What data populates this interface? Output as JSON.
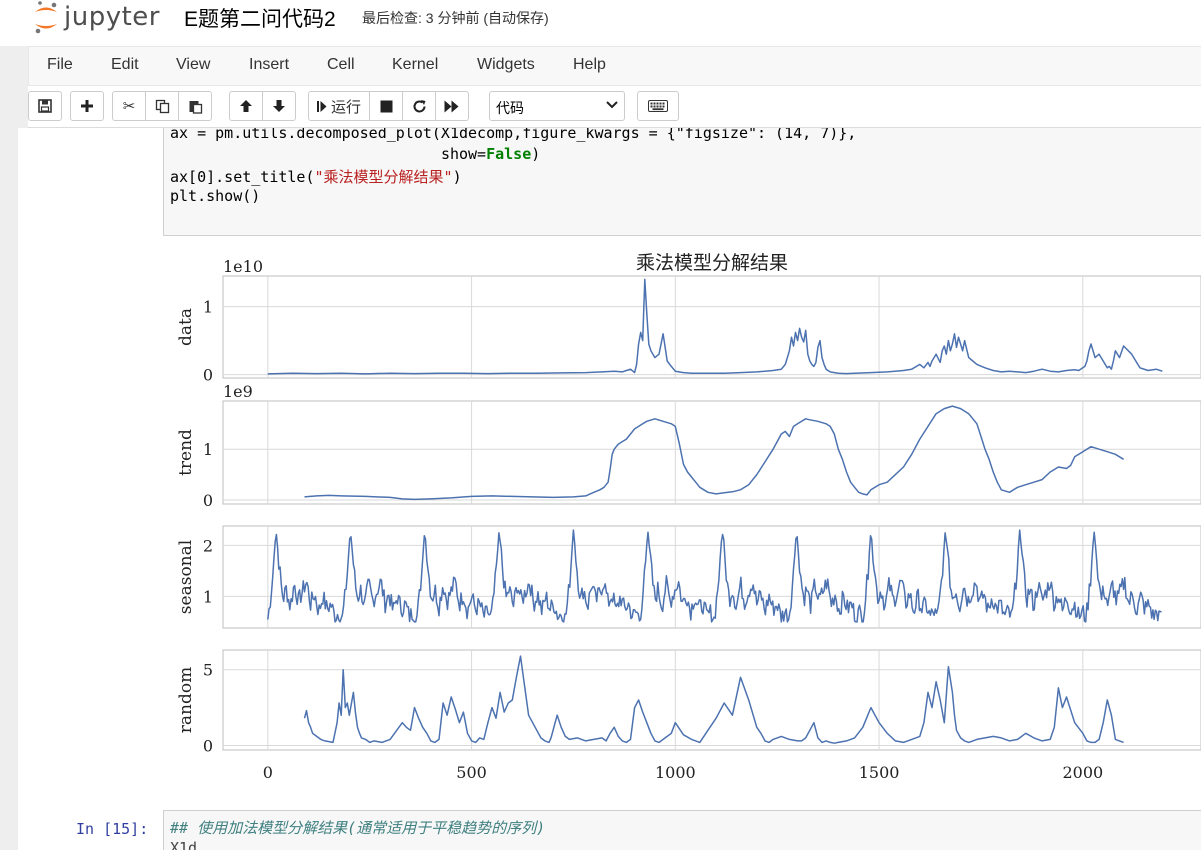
{
  "header": {
    "logo_text": "jupyter",
    "notebook_title": "E题第二问代码2",
    "status": "最后检查: 3 分钟前 (自动保存)"
  },
  "menu": [
    "File",
    "Edit",
    "View",
    "Insert",
    "Cell",
    "Kernel",
    "Widgets",
    "Help"
  ],
  "toolbar": {
    "run_label": "运行",
    "cell_type": "代码",
    "icons": [
      "save-icon",
      "plus-icon",
      "scissors-icon",
      "copy-icon",
      "paste-icon",
      "arrow-up-icon",
      "arrow-down-icon",
      "run-icon",
      "stop-icon",
      "restart-icon",
      "fast-forward-icon",
      "keyboard-icon"
    ]
  },
  "cell1": {
    "line1": "ax = pm.utils.decomposed_plot(X1decomp,figure_kwargs = {\"figsize\": (14, 7)},",
    "line2_prefix": "show=",
    "line2_kw": "False",
    "line2_suffix": ")",
    "line3_prefix": "ax[0].set_title(",
    "line3_str": "\"乘法模型分解结果\"",
    "line3_suffix": ")",
    "line4": "plt.show()"
  },
  "cell2": {
    "prompt": "In  [15]:",
    "comment": "## 使用加法模型分解结果(通常适用于平稳趋势的序列)",
    "partial_line": "X1d..."
  },
  "chart_data": [
    {
      "type": "line",
      "title": "乘法模型分解结果",
      "ylabel": "data",
      "offset_text": "1e10",
      "ylim": [
        -0.05,
        1.45
      ],
      "yticks": [
        0,
        1
      ],
      "xlim": [
        -110,
        2290
      ],
      "grid": true,
      "color": "#4c72b0",
      "x": [
        0,
        60,
        120,
        180,
        240,
        300,
        360,
        420,
        480,
        540,
        600,
        660,
        720,
        780,
        820,
        850,
        870,
        880,
        890,
        900,
        905,
        910,
        915,
        920,
        925,
        930,
        935,
        940,
        950,
        960,
        970,
        980,
        990,
        1000,
        1020,
        1040,
        1080,
        1120,
        1160,
        1200,
        1240,
        1260,
        1270,
        1280,
        1285,
        1290,
        1295,
        1300,
        1305,
        1310,
        1315,
        1320,
        1325,
        1330,
        1335,
        1340,
        1345,
        1350,
        1355,
        1360,
        1365,
        1370,
        1380,
        1390,
        1400,
        1420,
        1440,
        1480,
        1520,
        1560,
        1580,
        1600,
        1610,
        1620,
        1625,
        1630,
        1640,
        1650,
        1655,
        1660,
        1665,
        1670,
        1675,
        1680,
        1685,
        1690,
        1695,
        1700,
        1705,
        1710,
        1720,
        1730,
        1740,
        1760,
        1780,
        1800,
        1820,
        1840,
        1860,
        1880,
        1900,
        1920,
        1940,
        1960,
        1980,
        1990,
        2000,
        2005,
        2010,
        2015,
        2020,
        2030,
        2040,
        2050,
        2055,
        2060,
        2065,
        2070,
        2075,
        2080,
        2090,
        2100,
        2120,
        2140,
        2160,
        2180,
        2195
      ],
      "y": [
        0.01,
        0.02,
        0.015,
        0.02,
        0.01,
        0.02,
        0.015,
        0.02,
        0.02,
        0.015,
        0.02,
        0.02,
        0.025,
        0.03,
        0.04,
        0.05,
        0.04,
        0.06,
        0.08,
        0.03,
        0.15,
        0.45,
        0.62,
        0.5,
        1.4,
        0.9,
        0.45,
        0.35,
        0.25,
        0.3,
        0.6,
        0.2,
        0.12,
        0.05,
        0.03,
        0.02,
        0.02,
        0.02,
        0.03,
        0.04,
        0.06,
        0.08,
        0.15,
        0.35,
        0.55,
        0.42,
        0.62,
        0.5,
        0.68,
        0.55,
        0.48,
        0.65,
        0.3,
        0.2,
        0.15,
        0.12,
        0.18,
        0.4,
        0.5,
        0.25,
        0.15,
        0.08,
        0.04,
        0.03,
        0.02,
        0.015,
        0.02,
        0.03,
        0.04,
        0.06,
        0.08,
        0.15,
        0.1,
        0.18,
        0.12,
        0.2,
        0.3,
        0.18,
        0.35,
        0.42,
        0.3,
        0.5,
        0.35,
        0.45,
        0.6,
        0.4,
        0.55,
        0.45,
        0.35,
        0.5,
        0.25,
        0.2,
        0.15,
        0.1,
        0.06,
        0.04,
        0.05,
        0.04,
        0.03,
        0.05,
        0.08,
        0.05,
        0.04,
        0.06,
        0.07,
        0.06,
        0.1,
        0.12,
        0.2,
        0.35,
        0.45,
        0.25,
        0.3,
        0.2,
        0.15,
        0.1,
        0.12,
        0.08,
        0.2,
        0.35,
        0.25,
        0.42,
        0.3,
        0.1,
        0.06,
        0.08,
        0.05,
        0.04,
        0.04,
        0.03,
        0.02
      ]
    },
    {
      "type": "line",
      "ylabel": "trend",
      "offset_text": "1e9",
      "ylim": [
        -0.08,
        1.95
      ],
      "yticks": [
        0,
        1
      ],
      "xlim": [
        -110,
        2290
      ],
      "grid": true,
      "color": "#4c72b0",
      "x": [
        90,
        120,
        150,
        180,
        240,
        300,
        330,
        360,
        400,
        450,
        500,
        550,
        600,
        650,
        700,
        750,
        780,
        800,
        815,
        825,
        835,
        840,
        845,
        850,
        860,
        880,
        890,
        900,
        910,
        920,
        930,
        950,
        970,
        990,
        1000,
        1010,
        1020,
        1030,
        1040,
        1050,
        1060,
        1080,
        1100,
        1120,
        1140,
        1160,
        1180,
        1200,
        1220,
        1240,
        1250,
        1260,
        1270,
        1280,
        1290,
        1300,
        1310,
        1320,
        1330,
        1350,
        1370,
        1380,
        1390,
        1400,
        1410,
        1420,
        1430,
        1440,
        1450,
        1460,
        1470,
        1480,
        1500,
        1520,
        1540,
        1560,
        1580,
        1600,
        1620,
        1640,
        1660,
        1680,
        1700,
        1720,
        1740,
        1750,
        1760,
        1770,
        1780,
        1790,
        1800,
        1820,
        1840,
        1860,
        1880,
        1900,
        1920,
        1940,
        1960,
        1970,
        1980,
        2000,
        2020,
        2040,
        2060,
        2080,
        2090,
        2100
      ],
      "y": [
        0.06,
        0.08,
        0.09,
        0.08,
        0.07,
        0.05,
        0.02,
        0.01,
        0.02,
        0.04,
        0.07,
        0.08,
        0.07,
        0.06,
        0.05,
        0.06,
        0.08,
        0.15,
        0.2,
        0.25,
        0.35,
        0.6,
        0.9,
        1.0,
        1.1,
        1.2,
        1.3,
        1.4,
        1.45,
        1.5,
        1.55,
        1.6,
        1.55,
        1.5,
        1.45,
        1.1,
        0.7,
        0.55,
        0.45,
        0.35,
        0.25,
        0.15,
        0.12,
        0.14,
        0.16,
        0.2,
        0.3,
        0.5,
        0.75,
        1.0,
        1.15,
        1.3,
        1.35,
        1.25,
        1.45,
        1.5,
        1.55,
        1.6,
        1.58,
        1.55,
        1.5,
        1.45,
        1.3,
        1.0,
        0.8,
        0.55,
        0.35,
        0.25,
        0.15,
        0.12,
        0.1,
        0.2,
        0.3,
        0.35,
        0.5,
        0.65,
        0.9,
        1.2,
        1.45,
        1.7,
        1.8,
        1.85,
        1.8,
        1.7,
        1.5,
        1.25,
        1.0,
        0.8,
        0.55,
        0.35,
        0.2,
        0.15,
        0.25,
        0.3,
        0.35,
        0.4,
        0.55,
        0.65,
        0.62,
        0.68,
        0.85,
        0.95,
        1.05,
        1.0,
        0.95,
        0.9,
        0.85,
        0.8
      ]
    },
    {
      "type": "line",
      "ylabel": "seasonal",
      "ylim": [
        0.38,
        2.38
      ],
      "yticks": [
        1,
        2
      ],
      "xlim": [
        -110,
        2290
      ],
      "grid": true,
      "color": "#4c72b0",
      "period": 182.5,
      "x_range": [
        0,
        2195
      ],
      "base_shape_x": [
        0,
        5,
        12,
        20,
        28,
        33,
        38,
        45,
        55,
        65,
        75,
        85,
        95,
        105,
        115,
        125,
        135,
        145,
        155,
        165,
        175,
        182.5
      ],
      "base_shape_y": [
        0.55,
        0.85,
        1.4,
        2.3,
        1.6,
        1.2,
        0.95,
        1.15,
        0.8,
        1.25,
        0.9,
        1.1,
        1.3,
        0.85,
        1.05,
        0.7,
        1.0,
        0.75,
        0.85,
        0.6,
        0.7,
        0.55
      ],
      "noise": 0.18
    },
    {
      "type": "line",
      "ylabel": "random",
      "ylim": [
        -0.3,
        6.3
      ],
      "yticks": [
        0,
        5
      ],
      "xlim": [
        -110,
        2290
      ],
      "xticks": [
        0,
        500,
        1000,
        1500,
        2000
      ],
      "grid": true,
      "color": "#4c72b0",
      "x": [
        90,
        95,
        100,
        105,
        110,
        120,
        130,
        140,
        160,
        170,
        175,
        180,
        185,
        190,
        195,
        200,
        210,
        215,
        220,
        225,
        230,
        240,
        250,
        260,
        280,
        300,
        330,
        340,
        350,
        360,
        370,
        380,
        390,
        400,
        410,
        420,
        430,
        440,
        450,
        460,
        470,
        480,
        490,
        500,
        510,
        520,
        530,
        540,
        550,
        560,
        570,
        580,
        590,
        600,
        610,
        620,
        640,
        660,
        670,
        680,
        690,
        695,
        700,
        705,
        710,
        720,
        730,
        740,
        760,
        780,
        800,
        820,
        830,
        840,
        850,
        860,
        870,
        880,
        890,
        900,
        910,
        920,
        930,
        940,
        950,
        960,
        970,
        980,
        990,
        1000,
        1020,
        1040,
        1060,
        1080,
        1100,
        1120,
        1140,
        1160,
        1180,
        1200,
        1210,
        1220,
        1230,
        1240,
        1260,
        1280,
        1300,
        1310,
        1320,
        1330,
        1340,
        1350,
        1360,
        1370,
        1380,
        1390,
        1400,
        1420,
        1440,
        1460,
        1480,
        1500,
        1520,
        1540,
        1560,
        1580,
        1600,
        1610,
        1620,
        1630,
        1640,
        1650,
        1660,
        1670,
        1680,
        1685,
        1690,
        1700,
        1710,
        1720,
        1740,
        1760,
        1780,
        1800,
        1820,
        1840,
        1860,
        1880,
        1900,
        1920,
        1930,
        1940,
        1950,
        1960,
        1980,
        2000,
        2010,
        2020,
        2030,
        2040,
        2050,
        2060,
        2070,
        2080,
        2090,
        2100
      ],
      "y": [
        1.8,
        2.3,
        1.5,
        1.2,
        0.8,
        0.6,
        0.4,
        0.3,
        0.2,
        1.5,
        2.8,
        2.0,
        5.0,
        2.5,
        2.8,
        2.0,
        3.5,
        2.2,
        1.2,
        0.8,
        0.5,
        0.4,
        0.2,
        0.3,
        0.2,
        0.4,
        1.5,
        1.2,
        1.0,
        2.5,
        1.8,
        1.2,
        0.8,
        0.3,
        0.2,
        0.4,
        2.8,
        2.0,
        3.2,
        2.4,
        1.5,
        2.2,
        0.8,
        0.3,
        0.2,
        0.5,
        0.4,
        1.5,
        2.5,
        1.8,
        3.5,
        2.2,
        2.8,
        3.0,
        4.5,
        5.9,
        2.0,
        1.0,
        0.5,
        0.3,
        0.2,
        0.5,
        1.0,
        1.5,
        2.0,
        1.2,
        0.6,
        0.4,
        0.5,
        0.3,
        0.4,
        0.5,
        0.3,
        0.8,
        1.2,
        0.6,
        0.3,
        0.2,
        0.4,
        2.5,
        3.0,
        2.2,
        1.5,
        0.8,
        0.3,
        0.2,
        0.4,
        0.6,
        0.8,
        1.5,
        0.7,
        0.4,
        0.2,
        1.0,
        1.8,
        2.8,
        2.0,
        4.5,
        3.0,
        1.2,
        0.8,
        0.3,
        0.2,
        0.4,
        0.6,
        0.4,
        0.3,
        0.3,
        0.5,
        1.0,
        1.5,
        0.5,
        0.2,
        0.3,
        0.2,
        0.15,
        0.2,
        0.3,
        0.5,
        1.2,
        2.5,
        1.5,
        0.8,
        0.3,
        0.2,
        0.4,
        0.6,
        1.5,
        3.5,
        2.5,
        4.2,
        3.0,
        1.5,
        5.2,
        3.5,
        2.0,
        1.0,
        0.5,
        0.3,
        0.2,
        0.4,
        0.5,
        0.6,
        0.5,
        0.3,
        0.4,
        0.8,
        0.5,
        0.3,
        0.4,
        1.2,
        3.8,
        2.5,
        3.2,
        1.5,
        0.8,
        0.3,
        0.2,
        0.2,
        0.4,
        1.5,
        3.0,
        2.0,
        0.4,
        0.3,
        0.2,
        1.2,
        3.8
      ]
    }
  ]
}
